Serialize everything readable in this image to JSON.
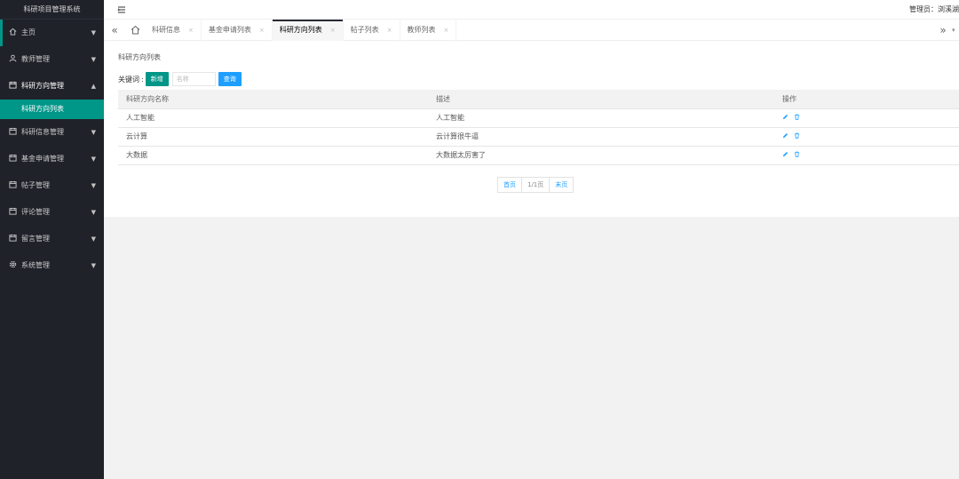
{
  "app": {
    "title": "科研项目管理系统"
  },
  "sidebar": {
    "items": [
      {
        "label": "主页",
        "icon": "home-icon"
      },
      {
        "label": "教师管理",
        "icon": "user-icon"
      },
      {
        "label": "科研方向管理",
        "icon": "calendar-icon",
        "open": true
      },
      {
        "label": "科研信息管理",
        "icon": "calendar-icon"
      },
      {
        "label": "基金申请管理",
        "icon": "calendar-icon"
      },
      {
        "label": "帖子管理",
        "icon": "calendar-icon"
      },
      {
        "label": "评论管理",
        "icon": "calendar-icon"
      },
      {
        "label": "留言管理",
        "icon": "calendar-icon"
      },
      {
        "label": "系统管理",
        "icon": "gear-icon"
      }
    ],
    "sub_items": [
      {
        "label": "科研方向列表"
      }
    ]
  },
  "header": {
    "admin_label": "管理员：浏溪湖"
  },
  "tabs": [
    {
      "label": "科研信息",
      "active": false
    },
    {
      "label": "基金申请列表",
      "active": false
    },
    {
      "label": "科研方向列表",
      "active": true
    },
    {
      "label": "帖子列表",
      "active": false
    },
    {
      "label": "教师列表",
      "active": false
    }
  ],
  "tab_close_glyph": "×",
  "main": {
    "breadcrumb": "科研方向列表",
    "search": {
      "label": "关键词",
      "add_label": "新增",
      "placeholder": "名称",
      "query_label": "查询"
    },
    "table": {
      "columns": [
        "科研方向名称",
        "描述",
        "操作"
      ],
      "rows": [
        [
          "人工智能",
          "人工智能"
        ],
        [
          "云计算",
          "云计算很牛逼"
        ],
        [
          "大数据",
          "大数据太厉害了"
        ]
      ]
    },
    "pager": {
      "first": "首页",
      "info": "1/1页",
      "last": "末页"
    }
  },
  "colors": {
    "sidebar_bg": "#20222a",
    "accent": "#009688",
    "primary": "#1e9fff"
  }
}
